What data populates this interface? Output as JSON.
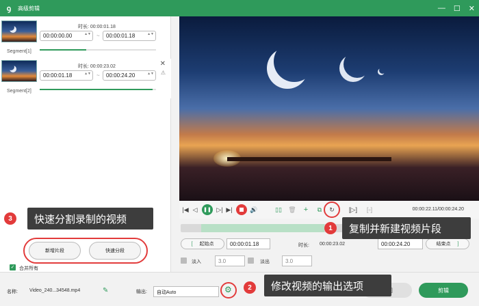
{
  "window": {
    "logo_glyph": "ꝯ",
    "title": "高级剪辑",
    "controls": [
      "—",
      "☐",
      "✕"
    ]
  },
  "segments": [
    {
      "label": "Segment[1]",
      "duration_label": "时长: 00:00:01.18",
      "start": "00:00:00.00",
      "end": "00:00:01.18",
      "progress": 0.4
    },
    {
      "label": "Segment[2]",
      "duration_label": "时长: 00:00:23.02",
      "start": "00:00:01.18",
      "end": "00:00:24.20",
      "progress": 0.97
    }
  ],
  "segment_extra": {
    "close_glyph": "✕",
    "warn_glyph": "⚠"
  },
  "spinner_glyph": "▲▼",
  "tilde": "~",
  "player": {
    "timecode": "00:00:22.11/00:00:24.20",
    "icons": [
      "|◀",
      "◁",
      "▷|",
      "▶|",
      "■",
      "🔊",
      "▯▯",
      "🗑",
      "+",
      "⧉",
      "↻",
      "[▷]",
      "[▫]"
    ],
    "play_glyph": "❚❚"
  },
  "trim": {
    "start_button": "起始点",
    "start_bracket": "[",
    "start_value": "00:00:01.18",
    "duration_label": "时长:",
    "duration_value": "00:00:23.02",
    "end_value": "00:00:24.20",
    "end_button": "结束点",
    "end_bracket": "]",
    "fade_in_label": "淡入",
    "fade_in_value": "3.0",
    "fade_out_label": "淡出",
    "fade_out_value": "3.0"
  },
  "left_actions": {
    "new_segment": "新增片段",
    "quick_split": "快速分段",
    "merge_all": "合并所有",
    "merge_checked": "✓"
  },
  "bottom": {
    "name_label": "名称:",
    "name_value": "Video_240...34548.mp4",
    "edit_glyph": "✎",
    "output_label": "输出:",
    "output_value": "自动Auto",
    "gear_glyph": "⚙",
    "back_button": "返回",
    "cut_button": "剪辑"
  },
  "callouts": [
    {
      "num": "1",
      "text": "复制并新建视频片段"
    },
    {
      "num": "2",
      "text": "修改视频的输出选项"
    },
    {
      "num": "3",
      "text": "快速分割录制的视频"
    }
  ],
  "colors": {
    "accent": "#2f9a5b",
    "highlight": "#e23b3b",
    "callout_bg": "#3d3d3d"
  }
}
